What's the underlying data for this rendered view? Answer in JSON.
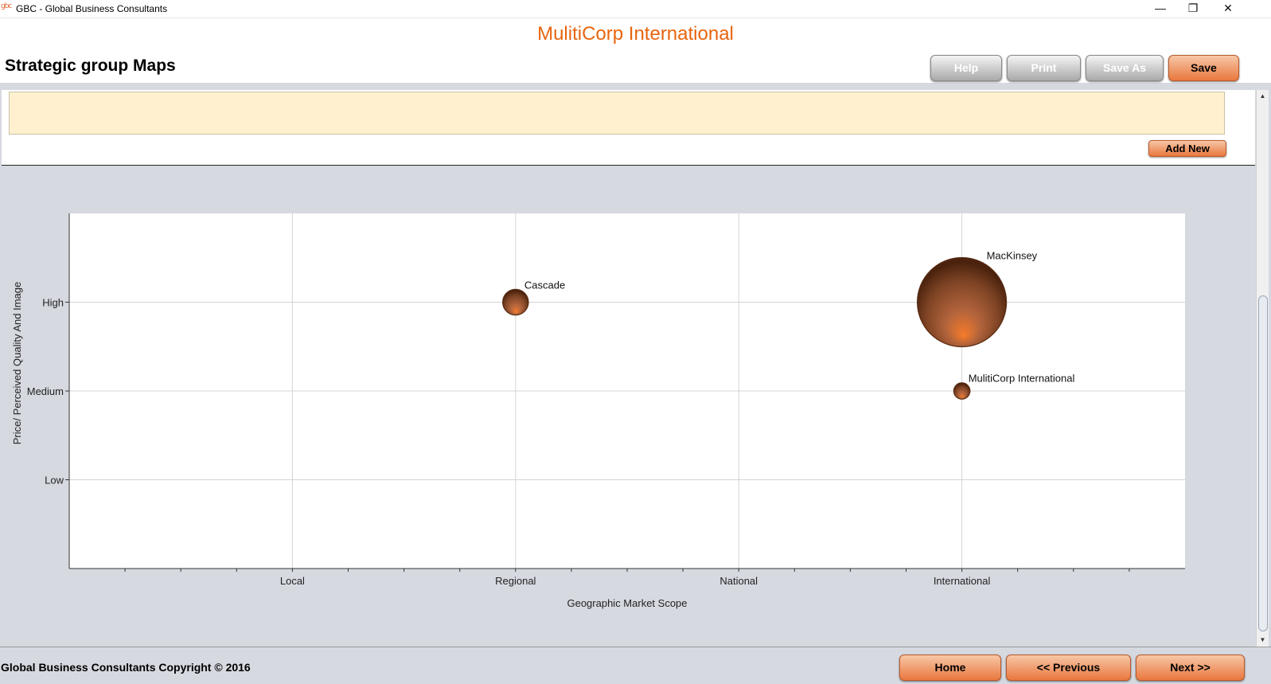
{
  "window": {
    "icon_text": "gbc",
    "title": "GBC - Global Business Consultants",
    "minimize": "—",
    "restore": "❐",
    "close": "✕"
  },
  "header": {
    "company": "MulitiCorp International",
    "page_title": "Strategic group Maps",
    "buttons": {
      "help": "Help",
      "print": "Print",
      "save_as": "Save As",
      "save": "Save"
    }
  },
  "panel": {
    "note_value": "",
    "add_new": "Add New"
  },
  "scrollbar": {
    "up_icon": "▲",
    "down_icon": "▼"
  },
  "chart_data": {
    "type": "scatter",
    "xlabel": "Geographic Market Scope",
    "ylabel": "Price/ Perceived Quality And Image",
    "x_categories": [
      "Local",
      "Regional",
      "National",
      "International"
    ],
    "y_categories": [
      "Low",
      "Medium",
      "High"
    ],
    "xlim": [
      0,
      5
    ],
    "ylim": [
      0,
      4
    ],
    "grid": true,
    "points": [
      {
        "label": "Cascade",
        "x": "Regional",
        "y": "High",
        "size": 1
      },
      {
        "label": "MacKinsey",
        "x": "International",
        "y": "High",
        "size": 12
      },
      {
        "label": "MulitiCorp International",
        "x": "International",
        "y": "Medium",
        "size": 0.4
      }
    ],
    "colors": {
      "bubble_dark": "#5a2c12",
      "bubble_mid": "#a9603a",
      "bubble_light": "#f07a2c"
    }
  },
  "footer": {
    "copyright": "Global Business Consultants Copyright © 2016",
    "home": "Home",
    "previous": "<< Previous",
    "next": "Next >>"
  }
}
